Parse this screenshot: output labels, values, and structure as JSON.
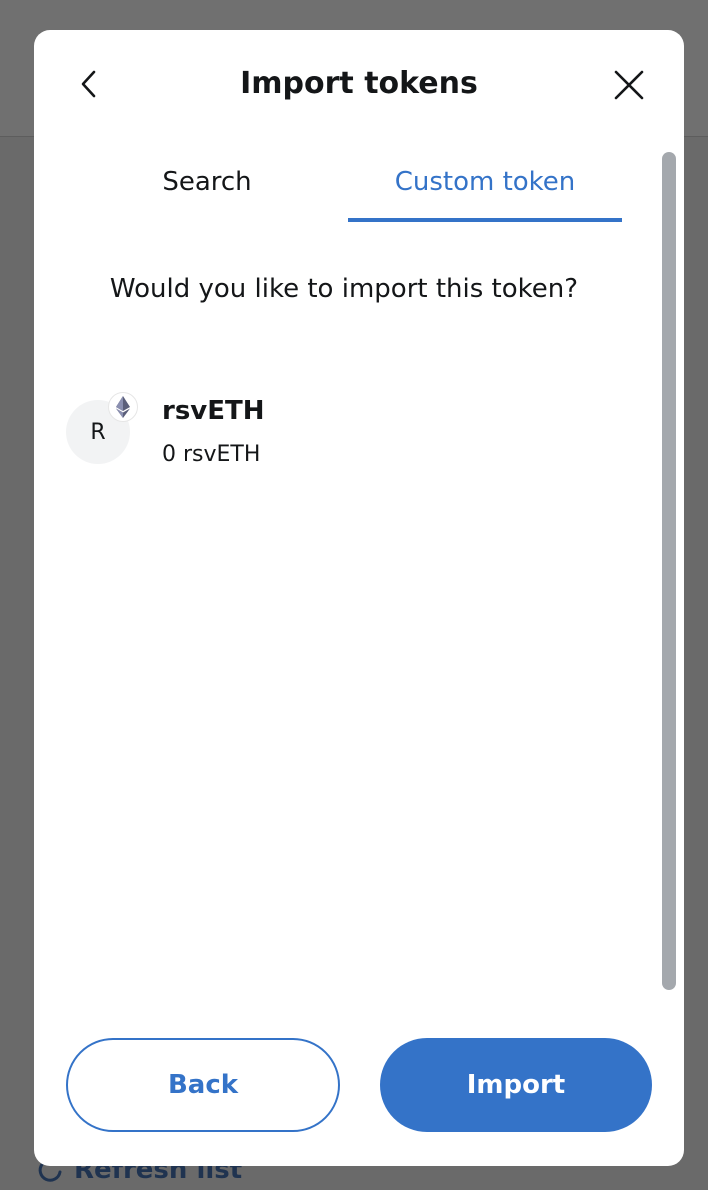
{
  "background": {
    "refresh_label": "Refresh list"
  },
  "header": {
    "title": "Import tokens"
  },
  "tabs": [
    {
      "label": "Search"
    },
    {
      "label": "Custom token"
    }
  ],
  "question": "Would you like to import this token?",
  "token": {
    "avatar_letter": "R",
    "symbol": "rsvETH",
    "balance": "0 rsvETH"
  },
  "buttons": {
    "back_label": "Back",
    "import_label": "Import"
  },
  "colors": {
    "accent": "#3473c8",
    "text": "#141618",
    "overlay": "#6a6a6a"
  }
}
